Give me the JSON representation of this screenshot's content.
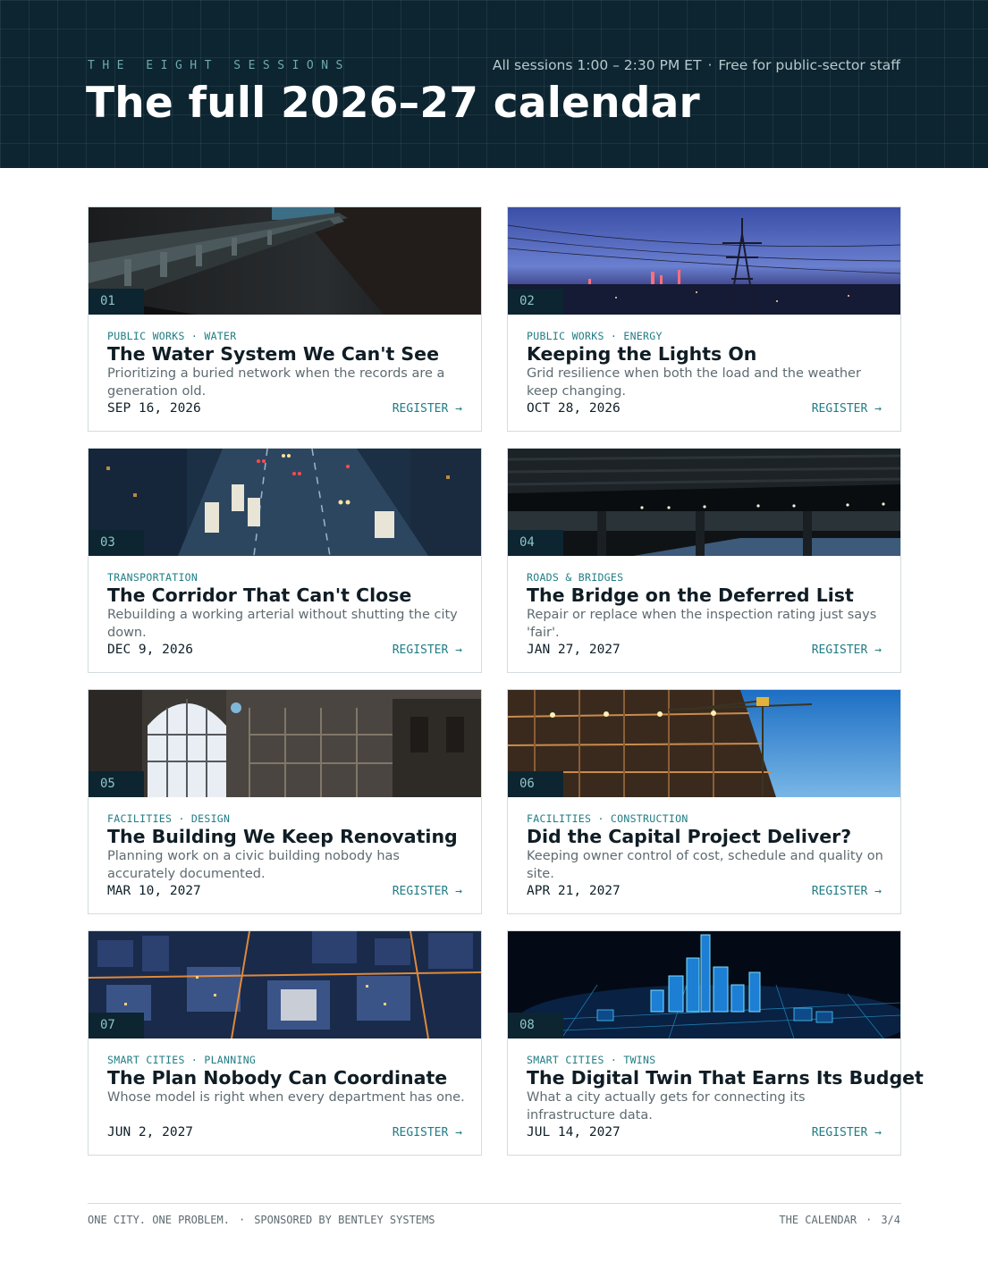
{
  "header": {
    "eyebrow": "THE EIGHT SESSIONS",
    "meta_time": "All sessions 1:00 – 2:30 PM ET",
    "meta_separator": "·",
    "meta_note": "Free for public-sector staff",
    "title": "The full 2026–27 calendar"
  },
  "sessions": [
    {
      "number": "01",
      "category": "PUBLIC WORKS · WATER",
      "title": "The Water System We Can't See",
      "description": "Prioritizing a buried network when the records are a generation old.",
      "date": "SEP 16, 2026",
      "register": "REGISTER →",
      "image": "pipes-in-trench-image"
    },
    {
      "number": "02",
      "category": "PUBLIC WORKS · ENERGY",
      "title": "Keeping the Lights On",
      "description": "Grid resilience when both the load and the weather keep changing.",
      "date": "OCT 28, 2026",
      "register": "REGISTER →",
      "image": "power-tower-dusk-image"
    },
    {
      "number": "03",
      "category": "TRANSPORTATION",
      "title": "The Corridor That Can't Close",
      "description": "Rebuilding a working arterial without shutting the city down.",
      "date": "DEC 9, 2026",
      "register": "REGISTER →",
      "image": "night-traffic-image"
    },
    {
      "number": "04",
      "category": "ROADS & BRIDGES",
      "title": "The Bridge on the Deferred List",
      "description": "Repair or replace when the inspection rating just says 'fair'.",
      "date": "JAN 27, 2027",
      "register": "REGISTER →",
      "image": "bridge-underside-image"
    },
    {
      "number": "05",
      "category": "FACILITIES · DESIGN",
      "title": "The Building We Keep Renovating",
      "description": "Planning work on a civic building nobody has accurately documented.",
      "date": "MAR 10, 2027",
      "register": "REGISTER →",
      "image": "civic-interior-image"
    },
    {
      "number": "06",
      "category": "FACILITIES · CONSTRUCTION",
      "title": "Did the Capital Project Deliver?",
      "description": "Keeping owner control of cost, schedule and quality on site.",
      "date": "APR 21, 2027",
      "register": "REGISTER →",
      "image": "construction-crane-image"
    },
    {
      "number": "07",
      "category": "SMART CITIES · PLANNING",
      "title": "The Plan Nobody Can Coordinate",
      "description": "Whose model is right when every department has one.",
      "date": "JUN 2, 2027",
      "register": "REGISTER →",
      "image": "city-aerial-night-image"
    },
    {
      "number": "08",
      "category": "SMART CITIES · TWINS",
      "title": "The Digital Twin That Earns Its Budget",
      "description": "What a city actually gets for connecting its infrastructure data.",
      "date": "JUL 14, 2027",
      "register": "REGISTER →",
      "image": "digital-twin-city-image"
    }
  ],
  "footer": {
    "left_a": "ONE CITY. ONE PROBLEM.",
    "left_b": "SPONSORED BY BENTLEY SYSTEMS",
    "right_a": "THE CALENDAR",
    "right_b": "3/4",
    "separator": "·"
  }
}
